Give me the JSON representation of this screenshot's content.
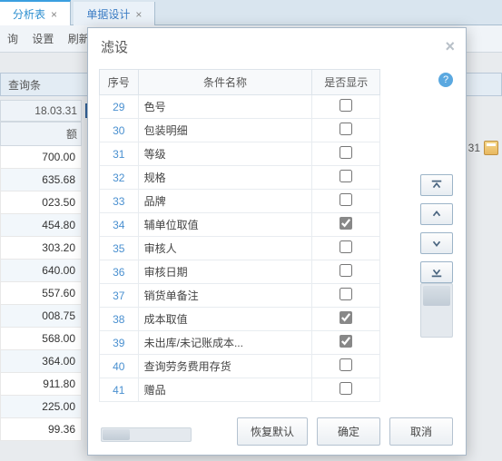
{
  "bg": {
    "tabs": [
      {
        "label": "分析表",
        "closable": true,
        "active": true
      },
      {
        "label": "单据设计",
        "closable": true,
        "active": false
      }
    ],
    "toolbar": [
      "询",
      "设置",
      "刷新"
    ],
    "filterbar_label": "查询条",
    "date_header": "18.03.31",
    "amount_header": "额",
    "side_date": "31",
    "grid_values": [
      "700.00",
      "635.68",
      "023.50",
      "454.80",
      "303.20",
      "640.00",
      "557.60",
      "008.75",
      "568.00",
      "364.00",
      "911.80",
      "225.00",
      "99.36"
    ]
  },
  "dialog": {
    "title": "滤设",
    "help_tooltip": "?",
    "columns": {
      "sn": "序号",
      "name": "条件名称",
      "show": "是否显示"
    },
    "rows": [
      {
        "sn": 29,
        "name": "色号",
        "checked": false
      },
      {
        "sn": 30,
        "name": "包装明细",
        "checked": false
      },
      {
        "sn": 31,
        "name": "等级",
        "checked": false
      },
      {
        "sn": 32,
        "name": "规格",
        "checked": false
      },
      {
        "sn": 33,
        "name": "品牌",
        "checked": false
      },
      {
        "sn": 34,
        "name": "辅单位取值",
        "checked": true
      },
      {
        "sn": 35,
        "name": "审核人",
        "checked": false
      },
      {
        "sn": 36,
        "name": "审核日期",
        "checked": false
      },
      {
        "sn": 37,
        "name": "销货单备注",
        "checked": false
      },
      {
        "sn": 38,
        "name": "成本取值",
        "checked": true
      },
      {
        "sn": 39,
        "name": "未出库/未记账成本...",
        "checked": true
      },
      {
        "sn": 40,
        "name": "查询劳务费用存货",
        "checked": false
      },
      {
        "sn": 41,
        "name": "赠品",
        "checked": false
      }
    ],
    "buttons": {
      "restore": "恢复默认",
      "ok": "确定",
      "cancel": "取消"
    }
  }
}
